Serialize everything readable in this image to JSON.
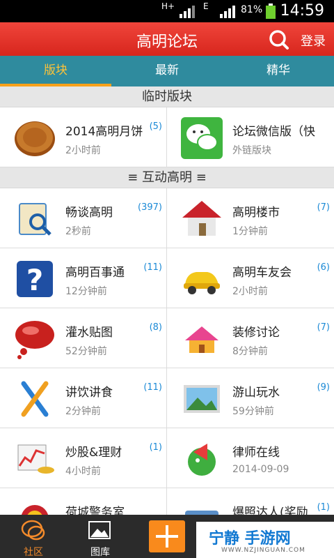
{
  "status_bar": {
    "network": "H+",
    "network2": "E",
    "battery": "81%",
    "time": "14:59"
  },
  "header": {
    "title": "高明论坛",
    "login": "登录"
  },
  "tabs": [
    "版块",
    "最新",
    "精华"
  ],
  "sections": {
    "temporary": "临时版块",
    "interactive": "≡  互动高明  ≡"
  },
  "temporary_boards": [
    {
      "name": "2014高明月饼",
      "count": "(5)",
      "time": "2小时前"
    },
    {
      "name": "论坛微信版（快",
      "count": "",
      "time": "外链版块"
    }
  ],
  "boards": [
    {
      "name": "畅谈高明",
      "count": "(397)",
      "time": "2秒前"
    },
    {
      "name": "高明楼市",
      "count": "(7)",
      "time": "1分钟前"
    },
    {
      "name": "高明百事通",
      "count": "(11)",
      "time": "12分钟前"
    },
    {
      "name": "高明车友会",
      "count": "(6)",
      "time": "2小时前"
    },
    {
      "name": "灌水贴图",
      "count": "(8)",
      "time": "52分钟前"
    },
    {
      "name": "装修讨论",
      "count": "(7)",
      "time": "8分钟前"
    },
    {
      "name": "讲饮讲食",
      "count": "(11)",
      "time": "2分钟前"
    },
    {
      "name": "游山玩水",
      "count": "(9)",
      "time": "59分钟前"
    },
    {
      "name": "炒股&理财",
      "count": "(1)",
      "time": "4小时前"
    },
    {
      "name": "律师在线",
      "count": "",
      "time": "2014-09-09"
    },
    {
      "name": "荷城警务室",
      "count": "",
      "time": ""
    },
    {
      "name": "爆照达人(奖励",
      "count": "(1)",
      "time": ""
    }
  ],
  "bottom_nav": {
    "community": "社区",
    "gallery": "图库"
  },
  "watermark": {
    "brand": "宁静 手游网",
    "url": "WWW.NZJINGUAN.COM"
  },
  "colors": {
    "header_red": "#e2352c",
    "tab_teal": "#2f8b9e",
    "tab_active": "#ffc338",
    "count_blue": "#1c8ad6",
    "add_orange": "#f98a1c"
  }
}
